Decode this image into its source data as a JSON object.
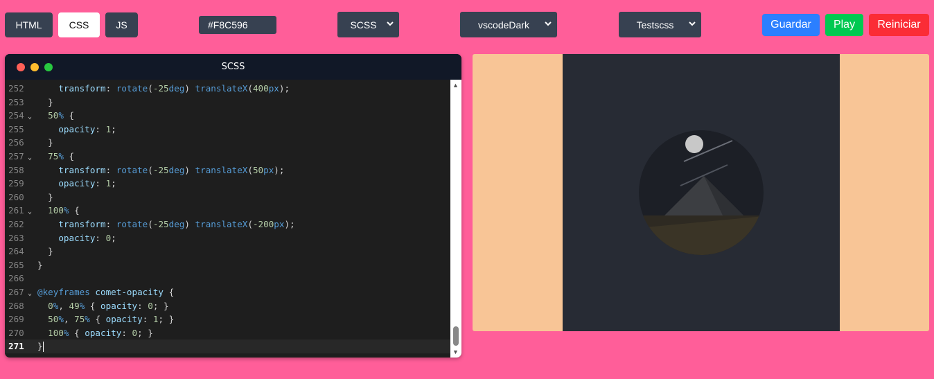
{
  "toolbar": {
    "tabs": [
      "HTML",
      "CSS",
      "JS"
    ],
    "active_tab": "CSS",
    "color_value": "#F8C596",
    "preprocessor": "SCSS",
    "theme": "vscodeDark",
    "project": "Testscss",
    "save_label": "Guardar",
    "play_label": "Play",
    "reset_label": "Reiniciar"
  },
  "editor": {
    "title": "SCSS",
    "lines": [
      {
        "n": "252",
        "fold": false,
        "html": "    <span class='p'>transform</span>: <span class='f'>rotate</span>(<span class='v'>-25</span><span class='u'>deg</span>) <span class='f'>translateX</span>(<span class='v'>400</span><span class='u'>px</span>);"
      },
      {
        "n": "253",
        "fold": false,
        "html": "  }"
      },
      {
        "n": "254",
        "fold": true,
        "html": "  <span class='v'>50</span><span class='u'>%</span> {"
      },
      {
        "n": "255",
        "fold": false,
        "html": "    <span class='p'>opacity</span>: <span class='v'>1</span>;"
      },
      {
        "n": "256",
        "fold": false,
        "html": "  }"
      },
      {
        "n": "257",
        "fold": true,
        "html": "  <span class='v'>75</span><span class='u'>%</span> {"
      },
      {
        "n": "258",
        "fold": false,
        "html": "    <span class='p'>transform</span>: <span class='f'>rotate</span>(<span class='v'>-25</span><span class='u'>deg</span>) <span class='f'>translateX</span>(<span class='v'>50</span><span class='u'>px</span>);"
      },
      {
        "n": "259",
        "fold": false,
        "html": "    <span class='p'>opacity</span>: <span class='v'>1</span>;"
      },
      {
        "n": "260",
        "fold": false,
        "html": "  }"
      },
      {
        "n": "261",
        "fold": true,
        "html": "  <span class='v'>100</span><span class='u'>%</span> {"
      },
      {
        "n": "262",
        "fold": false,
        "html": "    <span class='p'>transform</span>: <span class='f'>rotate</span>(<span class='v'>-25</span><span class='u'>deg</span>) <span class='f'>translateX</span>(<span class='v'>-200</span><span class='u'>px</span>);"
      },
      {
        "n": "263",
        "fold": false,
        "html": "    <span class='p'>opacity</span>: <span class='v'>0</span>;"
      },
      {
        "n": "264",
        "fold": false,
        "html": "  }"
      },
      {
        "n": "265",
        "fold": false,
        "html": "}"
      },
      {
        "n": "266",
        "fold": false,
        "html": ""
      },
      {
        "n": "267",
        "fold": true,
        "html": "<span class='k'>@keyframes</span> <span class='p'>comet-opacity</span> {"
      },
      {
        "n": "268",
        "fold": false,
        "html": "  <span class='v'>0</span><span class='u'>%</span>, <span class='v'>49</span><span class='u'>%</span> { <span class='p'>opacity</span>: <span class='v'>0</span>; }"
      },
      {
        "n": "269",
        "fold": false,
        "html": "  <span class='v'>50</span><span class='u'>%</span>, <span class='v'>75</span><span class='u'>%</span> { <span class='p'>opacity</span>: <span class='v'>1</span>; }"
      },
      {
        "n": "270",
        "fold": false,
        "html": "  <span class='v'>100</span><span class='u'>%</span> { <span class='p'>opacity</span>: <span class='v'>0</span>; }"
      },
      {
        "n": "271",
        "fold": false,
        "html": "}"
      }
    ]
  },
  "colors": {
    "background": "#FF5E99",
    "tab_bg": "#374151",
    "save": "#2B7FFF",
    "play": "#00C951",
    "reset": "#FB2C36",
    "preview_bg": "#F8C596",
    "canvas_bg": "#272B34"
  },
  "icons": {
    "select_chevron": "chevron-down-icon",
    "fold": "fold-chevron-icon"
  }
}
